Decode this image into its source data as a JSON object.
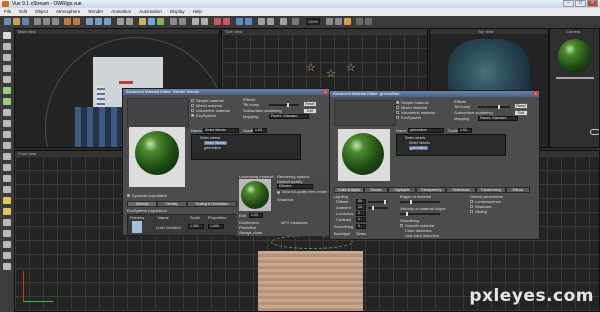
{
  "app": {
    "title": "Vue 9.1 xStream - OWRigs.vue",
    "menu": [
      "File",
      "Edit",
      "Object",
      "Atmosphere",
      "Render",
      "Animation",
      "Automation",
      "Display",
      "Help"
    ],
    "toolbar_readout": "100%"
  },
  "viewports": {
    "main_view": "Main view",
    "side_view": "Side view",
    "top_view": "Top view",
    "front_view": "Front view",
    "camera_label": "Camera"
  },
  "editor1": {
    "title": "Advanced Material Editor: Skinter Weeds",
    "material_types": [
      "Simple material",
      "Mixed material",
      "Volumetric material",
      "EcoSystem"
    ],
    "effects_header": "Effects",
    "effects": [
      "Tilt bump",
      "Subsurface scattering",
      "Mapping"
    ],
    "effects_buttons": [
      "Reset",
      "Edit"
    ],
    "mapping_value": "Parent: Standard",
    "name_label": "Name",
    "name_value": "Sinter Weeds",
    "scale_label": "Scale",
    "scale_value": "1.00",
    "tree": [
      "Sinter weeds",
      "Sinter Weeds",
      "greenslime"
    ],
    "dynamic_label": "Dynamic population",
    "tabs": [
      "General",
      "Density",
      "Scaling & Orientation",
      "Color",
      "Presence"
    ],
    "eco_header": "EcoSystem population",
    "table_headers": [
      "Preview",
      "Name",
      "Scale",
      "Proportion"
    ],
    "table_row": {
      "name": "Lush Ovoided",
      "scale": "1.000",
      "proportion": "1.000"
    },
    "preview_header": "Underlying material",
    "rendering_header": "Rendering options",
    "rendering_items": [
      "Default quality",
      "Efficient",
      "Allow full-quality trees render",
      "Shadows"
    ],
    "edit_label": "Edit",
    "scale_field": "1.00",
    "distribution_header": "Distribution",
    "distribution_items": [
      "Predefine",
      "Always close"
    ],
    "mfx_label": "MFX instances"
  },
  "editor2": {
    "title": "Advanced Material Editor: greenslime",
    "material_types": [
      "Simple material",
      "Mixed material",
      "Volumetric material",
      "EcoSystem"
    ],
    "effects_header": "Effects",
    "effects": [
      "Tilt bump",
      "Subsurface scattering",
      "Mapping"
    ],
    "effects_buttons": [
      "Reset",
      "Edit"
    ],
    "mapping_value": "Parent: Standard",
    "name_label": "Name",
    "name_value": "greenslime",
    "scale_label": "Scale",
    "scale_value": "1.00",
    "tree": [
      "Sinter weeds",
      "Sinter Weeds",
      "greenslime"
    ],
    "tabs": [
      "Color & Alpha",
      "Bumps",
      "Highlights",
      "Transparency",
      "Reflections",
      "Translucency",
      "Effects"
    ],
    "lighting_header": "Lighting",
    "lighting_items": [
      {
        "label": "Diffuse",
        "value": "80"
      },
      {
        "label": "Ambient",
        "value": "20"
      },
      {
        "label": "Luminous",
        "value": "0"
      },
      {
        "label": "Contrast",
        "value": "0"
      }
    ],
    "smoothing_label": "Smoothing",
    "smoothing_value": "0",
    "edges_header": "Edges of material",
    "velocity_header": "Velocity of material edges",
    "smooth_header": "Smoothing",
    "smooth_items": [
      "Smooth material",
      "Color distortion",
      "Use color distortion"
    ],
    "surface_header": "Global parameters",
    "surface_items": [
      "Luminescence",
      "Shadows",
      "Sliding"
    ],
    "backlight_header": "Backlight",
    "backlight_label": "Sides"
  },
  "watermark": "pxleyes.com"
}
